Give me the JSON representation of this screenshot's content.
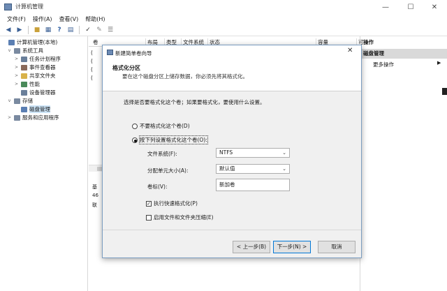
{
  "window": {
    "title": "计算机管理",
    "controls": [
      "—",
      "☐",
      "✕"
    ]
  },
  "menu": [
    "文件(F)",
    "操作(A)",
    "查看(V)",
    "帮助(H)"
  ],
  "toolbar": {
    "icons": [
      "back-icon",
      "forward-icon",
      "up-folder-icon",
      "show-tree-icon",
      "help-icon",
      "properties-icon",
      "check-icon",
      "export-icon",
      "list-icon"
    ]
  },
  "tree": {
    "items": [
      {
        "label": "计算机管理(本地)",
        "level": 0,
        "expander": "",
        "icon": "computer-icon",
        "color": "#5b7fb3"
      },
      {
        "label": "系统工具",
        "level": 1,
        "expander": "v",
        "icon": "tools-icon",
        "color": "#7a8aa0"
      },
      {
        "label": "任务计划程序",
        "level": 2,
        "expander": ">",
        "icon": "clock-icon",
        "color": "#6a7f9a"
      },
      {
        "label": "事件查看器",
        "level": 2,
        "expander": ">",
        "icon": "event-viewer-icon",
        "color": "#8a6a5a"
      },
      {
        "label": "共享文件夹",
        "level": 2,
        "expander": ">",
        "icon": "shared-folder-icon",
        "color": "#d8b24a"
      },
      {
        "label": "性能",
        "level": 2,
        "expander": ">",
        "icon": "performance-icon",
        "color": "#4a8a5a"
      },
      {
        "label": "设备管理器",
        "level": 2,
        "expander": "",
        "icon": "device-manager-icon",
        "color": "#6a7f9a"
      },
      {
        "label": "存储",
        "level": 1,
        "expander": "v",
        "icon": "storage-icon",
        "color": "#7a8aa0"
      },
      {
        "label": "磁盘管理",
        "level": 2,
        "expander": "",
        "icon": "disk-icon",
        "color": "#5b7fb3",
        "selected": true
      },
      {
        "label": "服务和应用程序",
        "level": 1,
        "expander": ">",
        "icon": "services-icon",
        "color": "#7a8aa0"
      }
    ]
  },
  "columns": [
    "卷",
    "布局",
    "类型",
    "文件系统",
    "状态",
    "容量",
    "可"
  ],
  "mid_rows": [
    "(",
    "(",
    "(",
    "("
  ],
  "low_strip": [
    "基",
    "46",
    "联"
  ],
  "actions": {
    "title": "操作",
    "section": "磁盘管理",
    "more": "更多操作",
    "arrow": "▶"
  },
  "dialog": {
    "title": "新建简单卷向导",
    "close": "✕",
    "heading": "格式化分区",
    "subheading": "要在这个磁盘分区上储存数据，你必须先将其格式化。",
    "prompt": "选择是否要格式化这个卷；如果要格式化，要使用什么设置。",
    "radio_no": "不要格式化这个卷(D)",
    "radio_yes": "按下列设置格式化这个卷(O):",
    "fs_label": "文件系统(F):",
    "fs_value": "NTFS",
    "alloc_label": "分配单元大小(A):",
    "alloc_value": "默认值",
    "volume_label": "卷标(V):",
    "volume_value": "新加卷",
    "quick_format": "执行快速格式化(P)",
    "quick_format_checked": true,
    "compress": "启用文件和文件夹压缩(E)",
    "compress_checked": false,
    "back": "< 上一步(B)",
    "next": "下一步(N) >",
    "cancel": "取消"
  }
}
